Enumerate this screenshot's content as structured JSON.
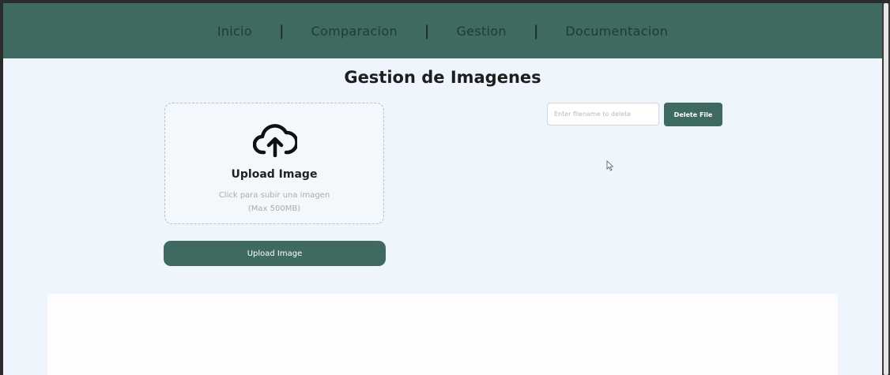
{
  "nav": {
    "items": [
      {
        "label": "Inicio"
      },
      {
        "label": "Comparacion"
      },
      {
        "label": "Gestion"
      },
      {
        "label": "Documentacion"
      }
    ],
    "separator": "|"
  },
  "page": {
    "title": "Gestion de Imagenes"
  },
  "upload": {
    "icon": "cloud-upload-icon",
    "heading": "Upload Image",
    "hint_line1": "Click para subir una imagen",
    "hint_line2": "(Max 500MB)",
    "button_label": "Upload Image"
  },
  "delete": {
    "placeholder": "Enter filename to delete",
    "button_label": "Delete File"
  },
  "colors": {
    "accent": "#3f6a62",
    "background": "#eef5fc"
  }
}
